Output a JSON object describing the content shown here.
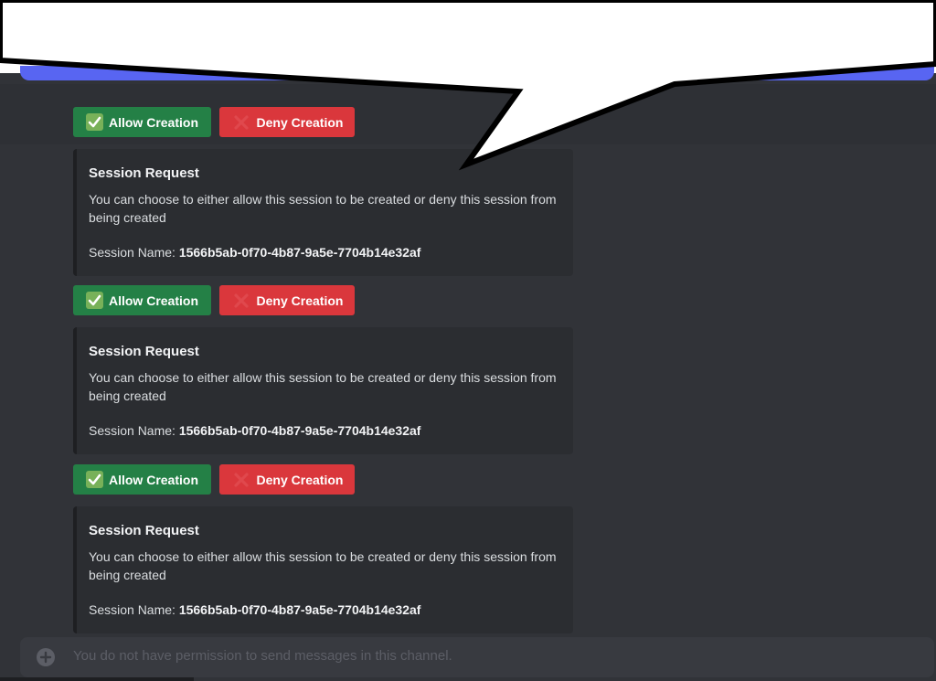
{
  "messages": [
    {
      "embed": null,
      "buttons": {
        "allow": "Allow Creation",
        "deny": "Deny Creation"
      }
    },
    {
      "embed": {
        "title": "Session Request",
        "description": "You can choose to either allow this session to be created or deny this session from being created",
        "field_label": "Session Name:",
        "field_value": "1566b5ab-0f70-4b87-9a5e-7704b14e32af"
      },
      "buttons": {
        "allow": "Allow Creation",
        "deny": "Deny Creation"
      }
    },
    {
      "embed": {
        "title": "Session Request",
        "description": "You can choose to either allow this session to be created or deny this session from being created",
        "field_label": "Session Name:",
        "field_value": "1566b5ab-0f70-4b87-9a5e-7704b14e32af"
      },
      "buttons": {
        "allow": "Allow Creation",
        "deny": "Deny Creation"
      }
    },
    {
      "embed": {
        "title": "Session Request",
        "description": "You can choose to either allow this session to be created or deny this session from being created",
        "field_label": "Session Name:",
        "field_value": "1566b5ab-0f70-4b87-9a5e-7704b14e32af"
      }
    }
  ],
  "composer": {
    "placeholder": "You do not have permission to send messages in this channel.",
    "icon": "plus-circle-icon"
  },
  "icons": {
    "allow": "check-mark-icon",
    "deny": "cross-mark-icon"
  },
  "colors": {
    "allow": "#248046",
    "deny": "#da373c",
    "accent": "#5865f2",
    "background": "#313338",
    "embed": "#2b2d31"
  }
}
